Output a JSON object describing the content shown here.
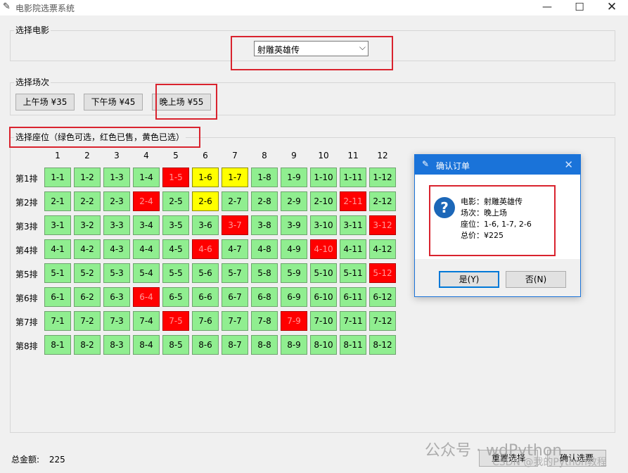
{
  "window": {
    "title": "电影院选票系统",
    "minimize": "—",
    "maximize": "☐",
    "close": "✕"
  },
  "movie_section": {
    "label": "选择电影",
    "selected": "射雕英雄传"
  },
  "session_section": {
    "label": "选择场次",
    "buttons": [
      {
        "label": "上午场 ¥35"
      },
      {
        "label": "下午场 ¥45"
      },
      {
        "label": "晚上场 ¥55"
      }
    ]
  },
  "seat_section": {
    "label": "选择座位（绿色可选，红色已售，黄色已选）",
    "columns": [
      "1",
      "2",
      "3",
      "4",
      "5",
      "6",
      "7",
      "8",
      "9",
      "10",
      "11",
      "12"
    ],
    "rows": [
      "第1排",
      "第2排",
      "第3排",
      "第4排",
      "第5排",
      "第6排",
      "第7排",
      "第8排"
    ],
    "sold": [
      "1-5",
      "2-4",
      "2-11",
      "3-7",
      "3-12",
      "4-6",
      "4-10",
      "5-12",
      "6-4",
      "7-5",
      "7-9"
    ],
    "selected": [
      "1-6",
      "1-7",
      "2-6"
    ]
  },
  "colors": {
    "available": "#90ee90",
    "sold": "#ff0000",
    "selected": "#ffff00",
    "accent": "#1a73d9",
    "highlight_box": "#d9232e"
  },
  "total": {
    "label": "总金额:",
    "value": "225"
  },
  "bottom_buttons": {
    "reset": "重置选择",
    "confirm": "确认选票"
  },
  "watermark": {
    "line1": "公众号 · wdPython",
    "line2": "CSDN @我的Python教程"
  },
  "dialog": {
    "title": "确认订单",
    "close": "✕",
    "icon": "question-icon",
    "lines": [
      "电影：射雕英雄传",
      "场次：晚上场",
      "座位：1-6, 1-7, 2-6",
      "总价：¥225"
    ],
    "yes": "是(Y)",
    "no": "否(N)"
  }
}
